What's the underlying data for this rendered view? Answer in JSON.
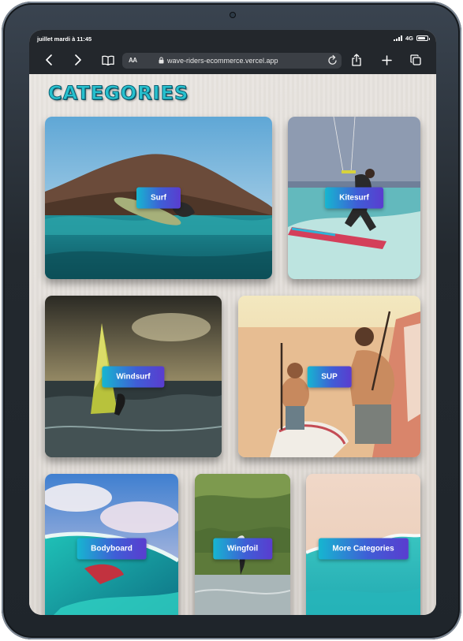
{
  "status_bar": {
    "time": "juillet mardi à 11:45",
    "network": "4G"
  },
  "browser": {
    "text_size_label": "AA",
    "url": "wave-riders-ecommerce.vercel.app"
  },
  "page": {
    "title": "CATEGORIES"
  },
  "categories": [
    {
      "label": "Surf"
    },
    {
      "label": "Kitesurf"
    },
    {
      "label": "Windsurf"
    },
    {
      "label": "SUP"
    },
    {
      "label": "Bodyboard"
    },
    {
      "label": "Wingfoil"
    },
    {
      "label": "More Categories"
    }
  ],
  "colors": {
    "accent_gradient_start": "#16b6d0",
    "accent_gradient_end": "#5a3ccf",
    "title_color": "#27c1ce",
    "browser_chrome": "#23272c"
  }
}
